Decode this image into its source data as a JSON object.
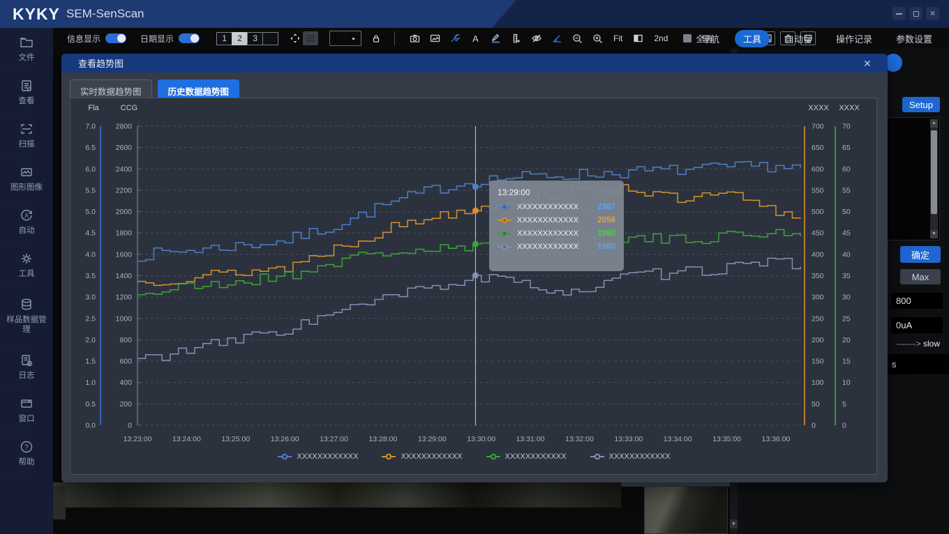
{
  "titlebar": {
    "logo": "KYKY",
    "app_name": "SEM-SenScan",
    "close_glyph": "✕"
  },
  "toolbar": {
    "toggles": [
      {
        "label": "信息显示",
        "on": true
      },
      {
        "label": "日期显示",
        "on": true
      }
    ],
    "view_buttons": [
      "1",
      "2",
      "3",
      ""
    ],
    "active_view_button": "2",
    "fit_label": "Fit",
    "second_label": "2nd",
    "select_all_label": "全选",
    "icon_names": [
      "expand-arrows-icon",
      "dotted-grid-icon",
      "scan-frame-icon",
      "fullscreen-icon",
      "lock-icon",
      "camera-icon",
      "image-icon",
      "wrench-icon",
      "text-a-icon",
      "pen-icon",
      "ruler-icon",
      "eye-off-icon",
      "angle-icon",
      "zoom-out-icon",
      "zoom-in-icon",
      "split-view-icon",
      "save-icon",
      "trash-icon",
      "monitor-icon"
    ]
  },
  "top_menu": {
    "items": [
      {
        "label": "导航",
        "active": false
      },
      {
        "label": "工具",
        "active": true
      },
      {
        "label": "自动台",
        "active": false
      },
      {
        "label": "操作记录",
        "active": false
      },
      {
        "label": "参数设置",
        "active": false
      }
    ]
  },
  "sidebar": {
    "items": [
      {
        "label": "文件",
        "icon": "folder-icon"
      },
      {
        "label": "查看",
        "icon": "report-icon"
      },
      {
        "label": "扫描",
        "icon": "scan-icon"
      },
      {
        "label": "图形图像",
        "icon": "picture-icon"
      },
      {
        "label": "自动",
        "icon": "auto-icon"
      },
      {
        "label": "工具",
        "icon": "gear-icon"
      },
      {
        "label": "样品数据管理",
        "icon": "database-icon"
      },
      {
        "label": "日志",
        "icon": "log-icon"
      },
      {
        "label": "窗口",
        "icon": "window-icon"
      },
      {
        "label": "帮助",
        "icon": "help-icon"
      }
    ]
  },
  "right_panel": {
    "setup_label": "Setup",
    "confirm_label": "确定",
    "max_label": "Max",
    "value_input": "800",
    "current_input": "0uA",
    "slow_dashes": "------->",
    "slow_label": "slow",
    "partial_input": "s"
  },
  "modal": {
    "title": "查看趋势图",
    "close_glyph": "✕",
    "tabs": [
      {
        "label": "实时数据趋势图",
        "active": false
      },
      {
        "label": "历史数据趋势图",
        "active": true
      }
    ],
    "tooltip": {
      "time": "13:29:00",
      "rows": [
        {
          "label": "XXXXXXXXXXXX",
          "value": "2367",
          "color": "#55a3f7"
        },
        {
          "label": "XXXXXXXXXXXX",
          "value": "2056",
          "color": "#e8a23a"
        },
        {
          "label": "XXXXXXXXXXXX",
          "value": "1980",
          "color": "#49d23f"
        },
        {
          "label": "XXXXXXXXXXXX",
          "value": "1980",
          "color": "#6d9be0"
        }
      ]
    },
    "chart_data": {
      "type": "line",
      "line_style": "step",
      "grid": "dashed-horizontal",
      "legend_position": "bottom-center",
      "axes": {
        "left_outer": {
          "title": "Fla",
          "min": 0,
          "max": 7,
          "step": 0.5,
          "decimals": 1,
          "color": "#3f6fd1"
        },
        "left_inner": {
          "title": "CCG",
          "min": 0,
          "max": 2800,
          "step": 200,
          "decimals": 0,
          "color": "#5f6e8c"
        },
        "right_inner": {
          "title": "XXXX",
          "min": 0,
          "max": 700,
          "step": 50,
          "decimals": 0,
          "color": "#d8922f"
        },
        "right_outer": {
          "title": "XXXX",
          "min": 0,
          "max": 70,
          "step": 5,
          "decimals": 0,
          "color": "#3fae3f"
        }
      },
      "x_ticks": [
        "13:23:00",
        "13:24:00",
        "13:25:00",
        "13:26:00",
        "13:27:00",
        "13:28:00",
        "13:29:00",
        "13:30:00",
        "13:31:00",
        "13:32:00",
        "13:33:00",
        "13:34:00",
        "13:35:00",
        "13:36:00"
      ],
      "x_span_seconds": 815,
      "step_seconds": 10,
      "anchor_minutes": [
        0,
        1,
        2,
        3,
        4,
        5,
        6,
        7,
        8,
        9,
        10,
        11,
        12,
        13,
        13.58
      ],
      "crosshair": {
        "x_seconds": 413,
        "time": "13:29:00"
      },
      "series": [
        {
          "name": "XXXXXXXXXXXX",
          "color": "#4c80c8",
          "seed": 7,
          "noise": 55,
          "anchors": [
            1590,
            1640,
            1680,
            1730,
            1870,
            2060,
            2210,
            2300,
            2330,
            2350,
            2370,
            2390,
            2410,
            2430,
            2400
          ]
        },
        {
          "name": "XXXXXXXXXXXX",
          "color": "#d5922d",
          "seed": 13,
          "noise": 55,
          "anchors": [
            1340,
            1390,
            1430,
            1480,
            1660,
            1830,
            1960,
            2060,
            2150,
            2180,
            2230,
            2100,
            2160,
            1990,
            1960
          ]
        },
        {
          "name": "XXXXXXXXXXXX",
          "color": "#3da43b",
          "seed": 21,
          "noise": 55,
          "anchors": [
            1230,
            1290,
            1340,
            1400,
            1530,
            1620,
            1640,
            1660,
            1700,
            1720,
            1750,
            1730,
            1780,
            1800,
            1810
          ]
        },
        {
          "name": "XXXXXXXXXXXX",
          "color": "#8093b5",
          "seed": 33,
          "noise": 55,
          "anchors": [
            620,
            700,
            800,
            900,
            1050,
            1180,
            1300,
            1380,
            1300,
            1250,
            1400,
            1420,
            1480,
            1520,
            1480
          ]
        }
      ]
    }
  }
}
